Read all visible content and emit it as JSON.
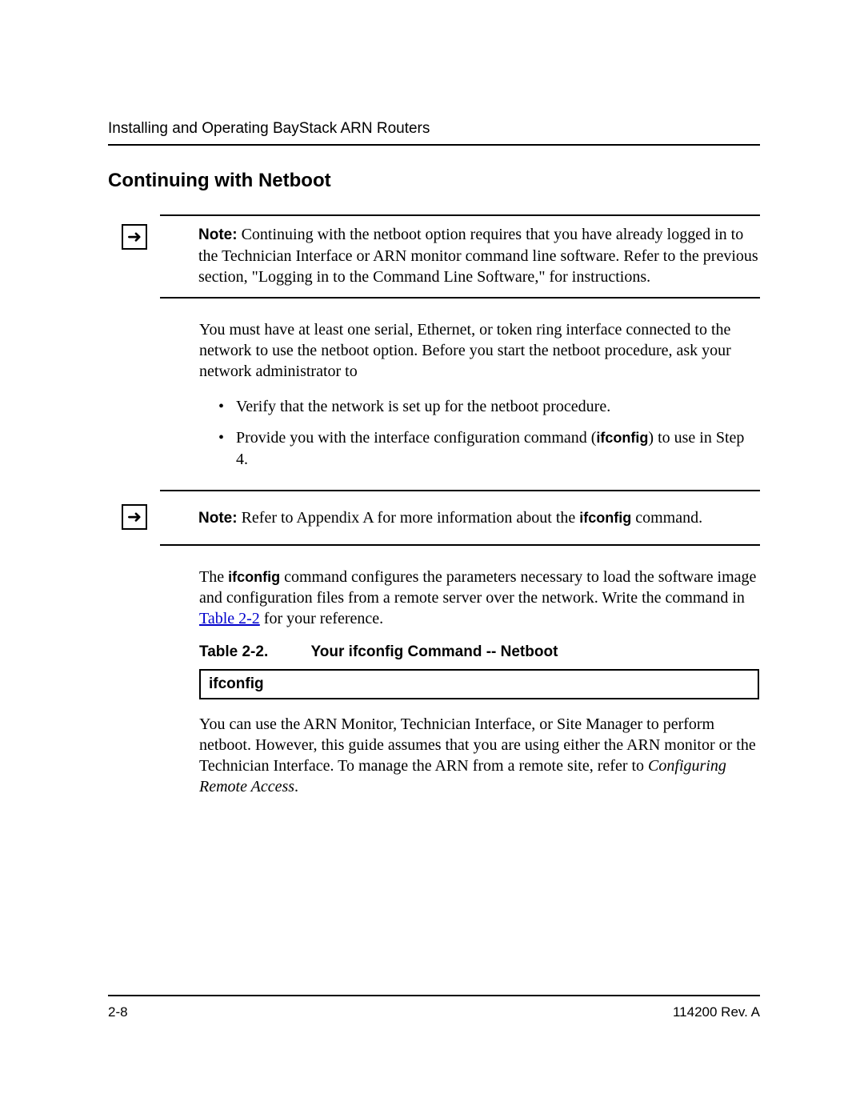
{
  "header": {
    "running_head": "Installing and Operating BayStack ARN Routers"
  },
  "section": {
    "title": "Continuing with Netboot"
  },
  "note1": {
    "label": "Note:",
    "text": "Continuing with the netboot option requires that you have already logged in to the Technician Interface or ARN monitor command line software. Refer to the previous section, \"Logging in to the Command Line Software,\" for instructions."
  },
  "para1": "You must have at least one serial, Ethernet, or token ring interface connected to the network to use the netboot option. Before you start the netboot procedure, ask your network administrator to",
  "bullets": [
    {
      "text_before": "Verify that the network is set up for the netboot procedure.",
      "bold": "",
      "text_after": ""
    },
    {
      "text_before": "Provide you with the interface configuration command (",
      "bold": "ifconfig",
      "text_after": ") to use in Step 4."
    }
  ],
  "note2": {
    "label": "Note:",
    "text_before": "Refer to Appendix A for more information about the ",
    "bold": "ifconfig",
    "text_after": " command."
  },
  "para2": {
    "t1": "The ",
    "b1": "ifconfig",
    "t2": " command configures the parameters necessary to load the software image and configuration files from a remote server over the network. Write the command in ",
    "link": "Table 2-2",
    "t3": " for your reference."
  },
  "table": {
    "caption_label": "Table 2-2.",
    "caption_title": "Your ifconfig Command -- Netboot",
    "cell": "ifconfig"
  },
  "para3": {
    "t1": "You can use the ARN Monitor, Technician Interface, or Site Manager to perform netboot. However, this guide assumes that you are using either the ARN monitor or the Technician Interface. To manage the ARN from a remote site, refer to ",
    "italic": "Configuring Remote Access",
    "t2": "."
  },
  "footer": {
    "left": "2-8",
    "right": "114200 Rev. A"
  },
  "icons": {
    "arrow": "➜"
  }
}
